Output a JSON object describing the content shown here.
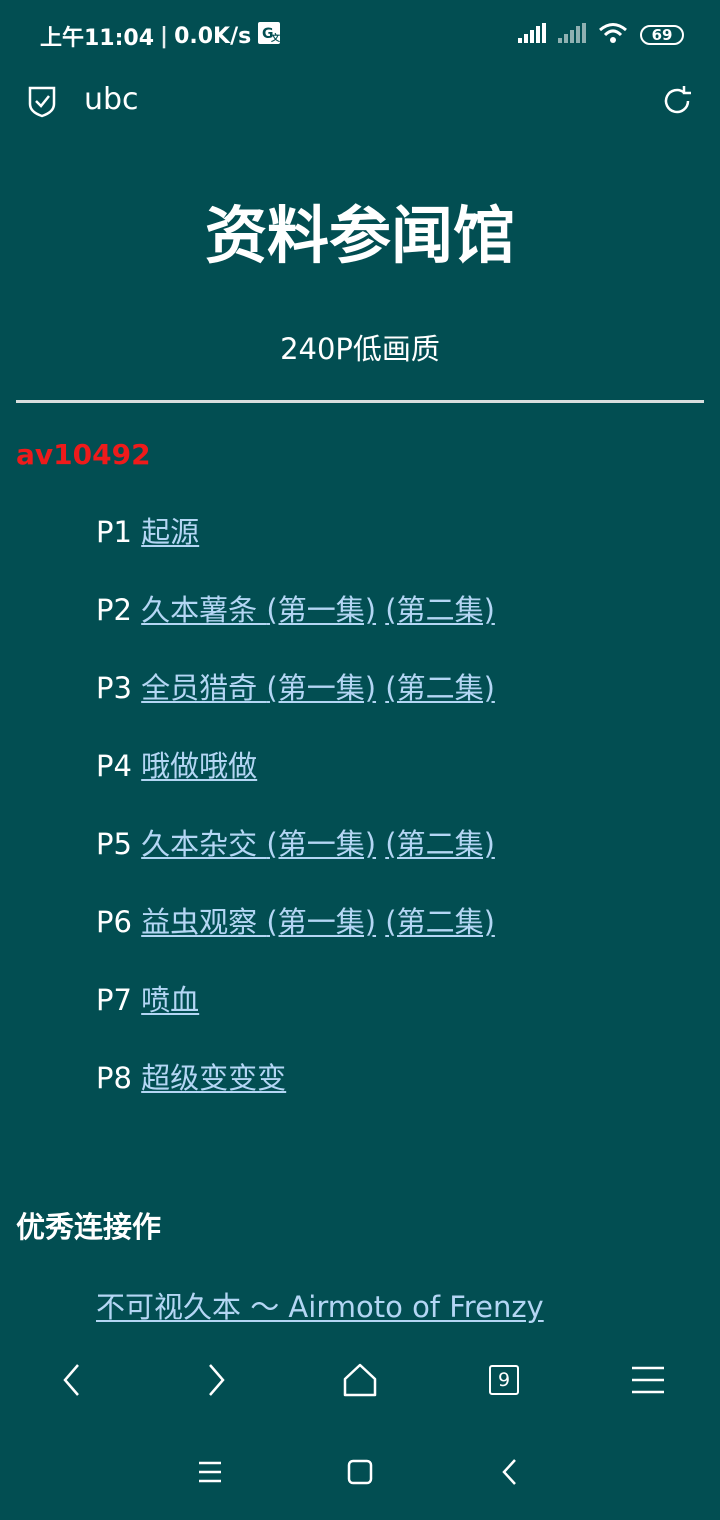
{
  "status_bar": {
    "time": "上午11:04",
    "speed": "0.0K/s",
    "battery": "69"
  },
  "address_bar": {
    "url": "ubc"
  },
  "page": {
    "title": "资料参闻馆",
    "subtitle": "240P低画质",
    "av_id": "av10492",
    "parts": [
      {
        "no": "P1",
        "title": "起源",
        "extra": []
      },
      {
        "no": "P2",
        "title": "久本薯条 ",
        "extra": [
          "(第一集)",
          "(第二集)"
        ]
      },
      {
        "no": "P3",
        "title": "全员猎奇 ",
        "extra": [
          "(第一集)",
          "(第二集)"
        ]
      },
      {
        "no": "P4",
        "title": "哦做哦做",
        "extra": []
      },
      {
        "no": "P5",
        "title": "久本杂交 ",
        "extra": [
          "(第一集)",
          "(第二集)"
        ]
      },
      {
        "no": "P6",
        "title": "益虫观察 ",
        "extra": [
          "(第一集)",
          "(第二集)"
        ]
      },
      {
        "no": "P7",
        "title": "喷血",
        "extra": []
      },
      {
        "no": "P8",
        "title": "超级变变变",
        "extra": []
      }
    ],
    "section_heading": "优秀连接作",
    "related_link": "不可视久本 ～ Airmoto of Frenzy"
  },
  "browser_nav": {
    "tab_count": "9"
  }
}
